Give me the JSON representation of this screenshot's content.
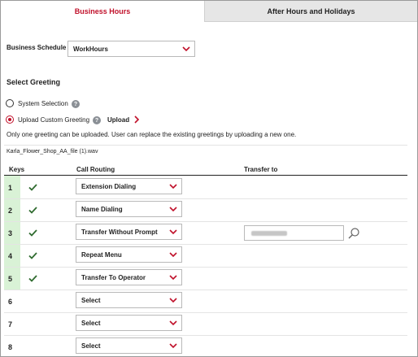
{
  "tabs": {
    "business_hours": "Business Hours",
    "after_hours": "After Hours and Holidays"
  },
  "schedule": {
    "label": "Business Schedule",
    "value": "WorkHours"
  },
  "greeting": {
    "heading": "Select Greeting",
    "system_selection": "System Selection",
    "upload_custom": "Upload Custom Greeting",
    "upload_link": "Upload",
    "note": "Only one greeting can be uploaded. User can replace the existing greetings by uploading a new one.",
    "file_name": "Karla_Flower_Shop_AA_file (1).wav"
  },
  "table": {
    "headers": {
      "keys": "Keys",
      "routing": "Call Routing",
      "transfer": "Transfer to"
    },
    "rows": [
      {
        "key": "1",
        "routing": "Extension Dialing",
        "checked": true
      },
      {
        "key": "2",
        "routing": "Name Dialing",
        "checked": true
      },
      {
        "key": "3",
        "routing": "Transfer Without Prompt",
        "checked": true
      },
      {
        "key": "4",
        "routing": "Repeat Menu",
        "checked": true
      },
      {
        "key": "5",
        "routing": "Transfer To Operator",
        "checked": true
      },
      {
        "key": "6",
        "routing": "Select",
        "checked": false
      },
      {
        "key": "7",
        "routing": "Select",
        "checked": false
      },
      {
        "key": "8",
        "routing": "Select",
        "checked": false
      }
    ]
  },
  "icons": {
    "help": "question-circle-icon",
    "chevron": "chevron-down-icon",
    "check": "check-icon",
    "search": "search-icon",
    "arrow": "chevron-right-icon"
  },
  "colors": {
    "accent": "#c0102a",
    "check": "#2f6b2f",
    "key_bg": "#d9f2d6"
  }
}
